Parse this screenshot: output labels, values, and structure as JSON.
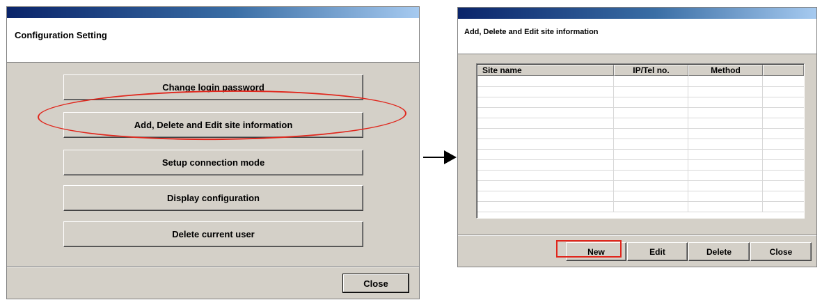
{
  "left_dialog": {
    "title": "Configuration Setting",
    "buttons": [
      "Change login password",
      "Add, Delete and Edit site information",
      "Setup connection mode",
      "Display configuration",
      "Delete current user"
    ],
    "close_label": "Close"
  },
  "right_dialog": {
    "title": "Add, Delete and Edit site information",
    "table": {
      "columns": [
        "Site name",
        "IP/Tel no.",
        "Method",
        ""
      ],
      "rows": []
    },
    "buttons": {
      "new": "New",
      "edit": "Edit",
      "delete": "Delete",
      "close": "Close"
    }
  },
  "annotations": {
    "highlight_color": "#e0261c",
    "arrow_icon": "right-arrow-icon"
  }
}
